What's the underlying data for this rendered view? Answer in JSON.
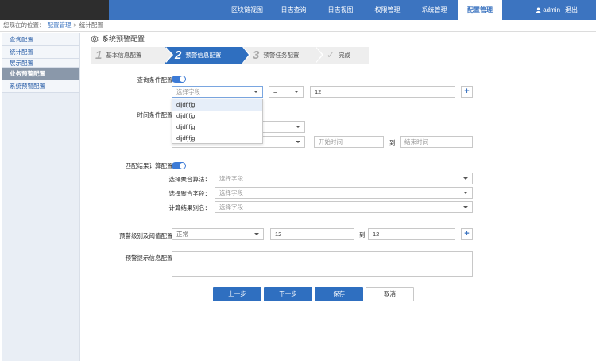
{
  "nav": {
    "items": [
      "区块链视图",
      "日志查询",
      "日志视图",
      "权限管理",
      "系统管理",
      "配置管理"
    ],
    "active_index": 5,
    "user": "admin",
    "logout": "退出"
  },
  "breadcrumb": {
    "prefix": "您现在的位置：",
    "level1": "配置管理",
    "separator": ">",
    "level2": "统计配置"
  },
  "sidebar": {
    "items": [
      {
        "label": "查询配置"
      },
      {
        "label": "统计配置"
      },
      {
        "label": "展示配置"
      },
      {
        "label": "业务预警配置"
      },
      {
        "label": "系统预警配置"
      }
    ],
    "active_index": 3
  },
  "page": {
    "title": "系统预警配置"
  },
  "steps": [
    {
      "num": "1",
      "label": "基本信息配置"
    },
    {
      "num": "2",
      "label": "预警信息配置"
    },
    {
      "num": "3",
      "label": "预警任务配置"
    },
    {
      "num": "✓",
      "label": "完成"
    }
  ],
  "form": {
    "query_condition": {
      "label": "查询条件配置：",
      "toggle_on": true,
      "field_placeholder": "选择字段",
      "operator": "=",
      "value": "12"
    },
    "dropdown": {
      "options": [
        "djjdfjfjg",
        "djjdfjfjg",
        "djjdfjfjg",
        "djjdfjfjg"
      ],
      "highlighted_index": 0
    },
    "time_condition": {
      "label": "时间条件配置：",
      "start_placeholder": "开始时间",
      "to": "到",
      "end_placeholder": "结束时间"
    },
    "match_result": {
      "label": "匹配结果计算配置：",
      "toggle_on": true,
      "algo_label": "选择聚合算法：",
      "algo_placeholder": "选择字段",
      "field_label": "选择聚合字段：",
      "field_placeholder": "选择字段",
      "alias_label": "计算结果别名：",
      "alias_placeholder": "选择字段"
    },
    "threshold": {
      "label": "预警级别及阈值配置：",
      "level": "正常",
      "min": "12",
      "to": "到",
      "max": "12"
    },
    "prompt": {
      "label": "预警提示信息配置："
    }
  },
  "buttons": {
    "prev": "上一步",
    "next": "下一步",
    "save": "保存",
    "cancel": "取消"
  },
  "colors": {
    "nav_bg": "#3c74c0",
    "accent": "#2f6fc0",
    "toggle": "#3d7bd6"
  }
}
